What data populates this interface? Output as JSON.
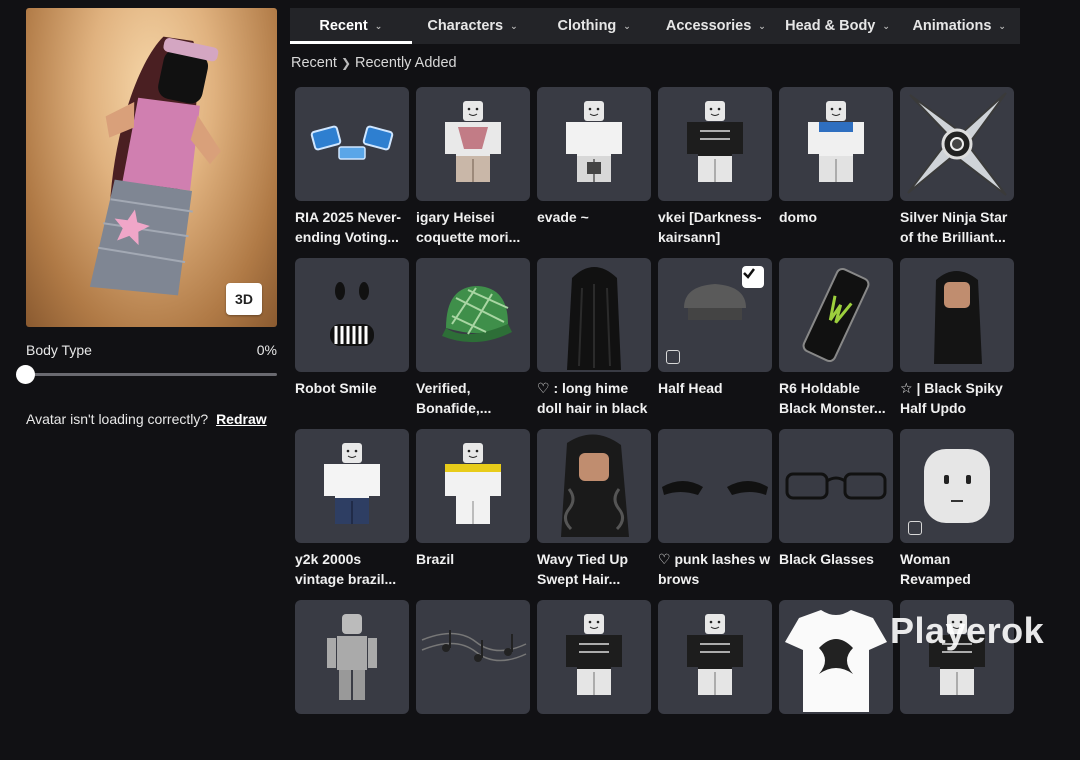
{
  "avatar": {
    "view_toggle_label": "3D"
  },
  "body_type": {
    "label": "Body Type",
    "value": "0%",
    "level_percent": 0
  },
  "redraw": {
    "message": "Avatar isn't loading correctly?",
    "link": "Redraw"
  },
  "tabs": [
    {
      "label": "Recent",
      "active": true
    },
    {
      "label": "Characters",
      "active": false
    },
    {
      "label": "Clothing",
      "active": false
    },
    {
      "label": "Accessories",
      "active": false
    },
    {
      "label": "Head & Body",
      "active": false
    },
    {
      "label": "Animations",
      "active": false
    }
  ],
  "breadcrumb": {
    "root": "Recent",
    "current": "Recently Added"
  },
  "items": [
    {
      "name": "RIA 2025 Never-ending Voting...",
      "icon": "glasses-blue",
      "worn": false
    },
    {
      "name": "igary Heisei coquette mori...",
      "icon": "shirt-pink",
      "worn": false
    },
    {
      "name": "evade ~",
      "icon": "shirt-white",
      "worn": false
    },
    {
      "name": "vkei [Darkness-kairsann]",
      "icon": "shirt-black",
      "worn": false
    },
    {
      "name": "domo",
      "icon": "shirt-blue",
      "worn": false
    },
    {
      "name": "Silver Ninja Star of the Brilliant...",
      "icon": "ninja-star",
      "worn": false
    },
    {
      "name": "Robot Smile",
      "icon": "face",
      "worn": false
    },
    {
      "name": "Verified, Bonafide,...",
      "icon": "cap",
      "worn": false
    },
    {
      "name": "♡ : long hime doll hair in black",
      "icon": "hair-black",
      "worn": false
    },
    {
      "name": "Half Head",
      "icon": "half-head",
      "worn": true
    },
    {
      "name": "R6 Holdable Black Monster...",
      "icon": "can",
      "worn": false
    },
    {
      "name": "☆ | Black Spiky Half Updo",
      "icon": "hair-updo",
      "worn": false
    },
    {
      "name": "y2k 2000s vintage brazil...",
      "icon": "shirt-jeans",
      "worn": false
    },
    {
      "name": "Brazil",
      "icon": "shirt-yellow",
      "worn": false
    },
    {
      "name": "Wavy Tied Up Swept Hair...",
      "icon": "hair-wavy",
      "worn": false
    },
    {
      "name": "♡ punk lashes w brows",
      "icon": "lashes",
      "worn": false
    },
    {
      "name": "Black Glasses",
      "icon": "glasses-black",
      "worn": false
    },
    {
      "name": "Woman Revamped",
      "icon": "head",
      "worn": false
    },
    {
      "name": "",
      "icon": "figure-grey",
      "worn": false
    },
    {
      "name": "",
      "icon": "music-notes",
      "worn": false
    },
    {
      "name": "",
      "icon": "shirt-black",
      "worn": false
    },
    {
      "name": "",
      "icon": "shirt-black",
      "worn": false
    },
    {
      "name": "",
      "icon": "tshirt-print",
      "worn": false
    },
    {
      "name": "",
      "icon": "shirt-black",
      "worn": false
    }
  ],
  "watermark": "Playerok"
}
